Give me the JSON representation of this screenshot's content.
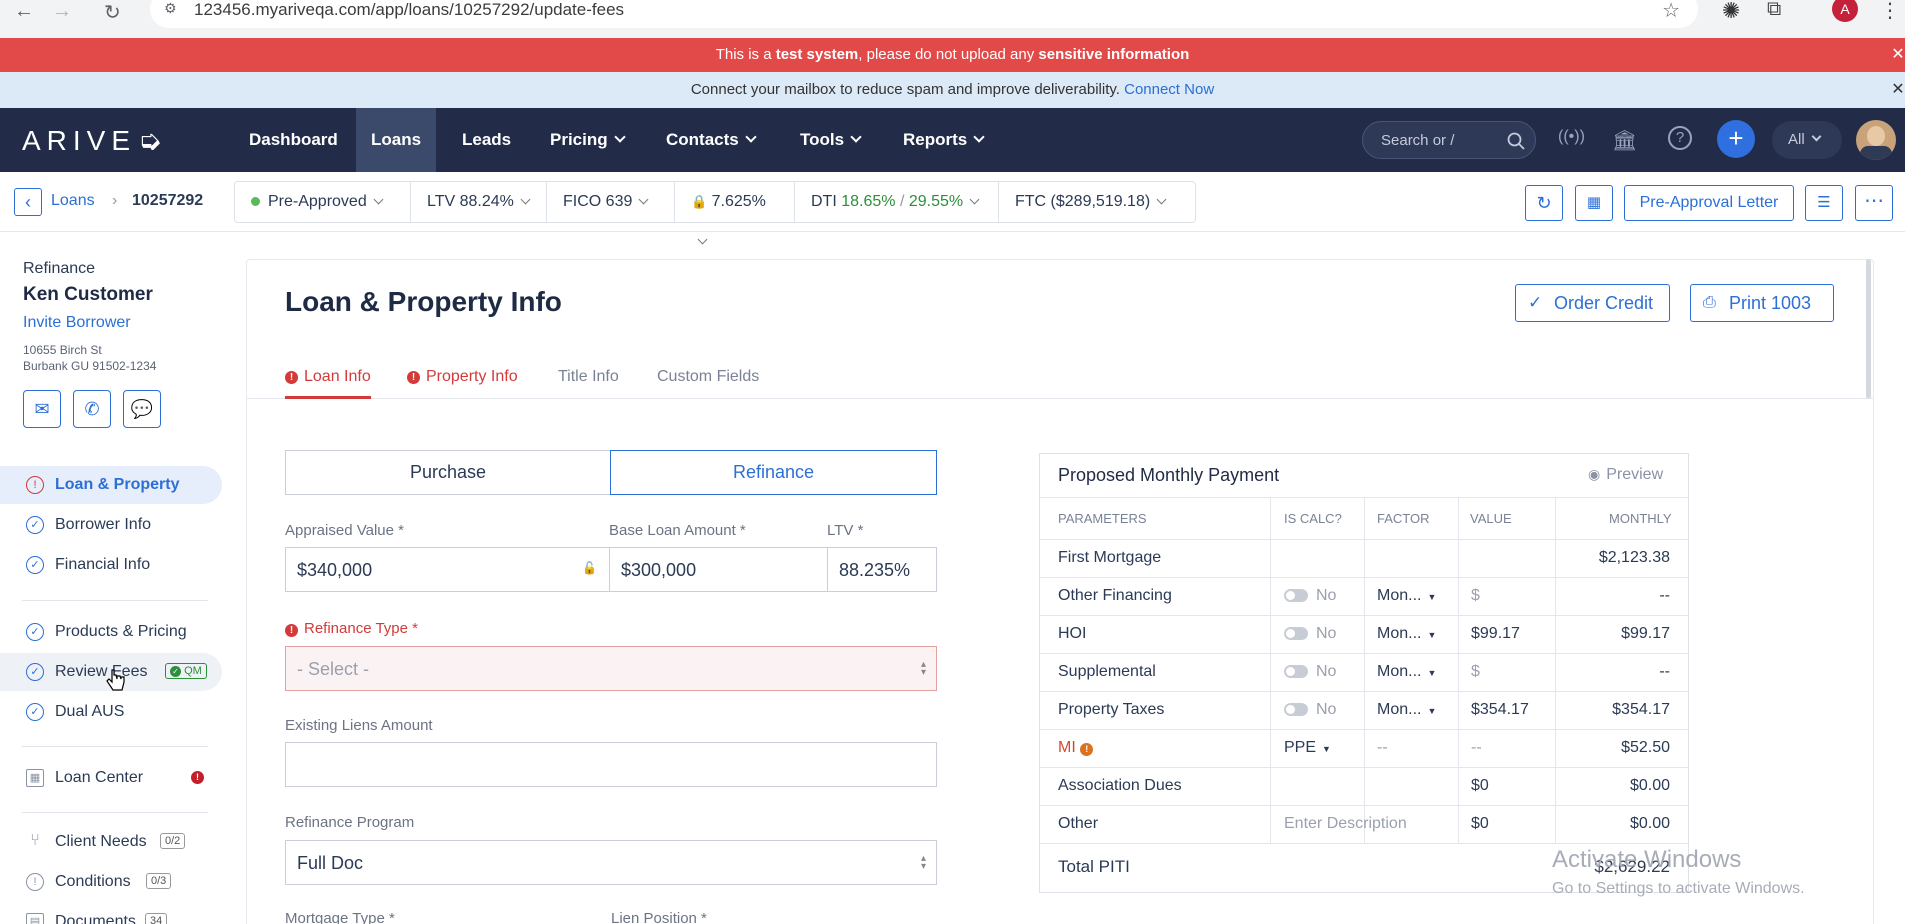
{
  "browser": {
    "url": "123456.myariveqa.com/app/loans/10257292/update-fees",
    "profile_initial": "A"
  },
  "banners": {
    "warning_prefix": "This is a ",
    "warning_bold1": "test system",
    "warning_mid": ", please do not upload any ",
    "warning_bold2": "sensitive information",
    "mailbox_text": "Connect your mailbox to reduce spam and improve deliverability.",
    "mailbox_link": "Connect Now"
  },
  "nav": {
    "logo": "ARIVE",
    "items": [
      {
        "label": "Dashboard"
      },
      {
        "label": "Loans"
      },
      {
        "label": "Leads"
      },
      {
        "label": "Pricing"
      },
      {
        "label": "Contacts"
      },
      {
        "label": "Tools"
      },
      {
        "label": "Reports"
      }
    ],
    "search_placeholder": "Search or /",
    "filter": "All"
  },
  "loanbar": {
    "crumb_loans": "Loans",
    "loan_number": "10257292",
    "status": "Pre-Approved",
    "ltv_label": "LTV",
    "ltv_value": "88.24%",
    "fico_label": "FICO",
    "fico_value": "639",
    "rate": "7.625%",
    "dti_label": "DTI",
    "dti_front": "18.65%",
    "dti_sep": " / ",
    "dti_back": "29.55%",
    "ftc": "FTC ($289,519.18)",
    "pre_approval_letter": "Pre-Approval Letter"
  },
  "borrower": {
    "loan_type": "Refinance",
    "name": "Ken Customer",
    "invite": "Invite Borrower",
    "address1": "10655 Birch St",
    "address2": "Burbank GU 91502-1234"
  },
  "sidebar": {
    "items": [
      {
        "label": "Loan & Property"
      },
      {
        "label": "Borrower Info"
      },
      {
        "label": "Financial Info"
      },
      {
        "label": "Products & Pricing"
      },
      {
        "label": "Review Fees",
        "badge": "QM"
      },
      {
        "label": "Dual AUS"
      },
      {
        "label": "Loan Center"
      },
      {
        "label": "Client Needs",
        "badge": "0/2"
      },
      {
        "label": "Conditions",
        "badge": "0/3"
      },
      {
        "label": "Documents",
        "badge": "34"
      }
    ]
  },
  "main": {
    "title": "Loan & Property Info",
    "order_credit": "Order Credit",
    "print_1003": "Print 1003",
    "tabs": [
      {
        "label": "Loan Info"
      },
      {
        "label": "Property Info"
      },
      {
        "label": "Title Info"
      },
      {
        "label": "Custom Fields"
      }
    ],
    "purpose_options": [
      "Purchase",
      "Refinance"
    ],
    "appraised_label": "Appraised Value *",
    "appraised_value": "$340,000",
    "base_loan_label": "Base Loan Amount *",
    "base_loan_value": "$300,000",
    "ltv_label": "LTV *",
    "ltv_value": "88.235%",
    "refi_type_label": "Refinance Type *",
    "refi_type_value": "- Select -",
    "liens_label": "Existing Liens Amount",
    "liens_value": "",
    "refi_program_label": "Refinance Program",
    "refi_program_value": "Full Doc",
    "mortgage_type_label": "Mortgage Type *",
    "lien_position_label": "Lien Position *"
  },
  "payment": {
    "title": "Proposed Monthly Payment",
    "preview": "Preview",
    "headers": [
      "PARAMETERS",
      "IS CALC?",
      "FACTOR",
      "VALUE",
      "MONTHLY"
    ],
    "rows": [
      {
        "param": "First Mortgage",
        "calc": "",
        "factor": "",
        "value": "",
        "monthly": "$2,123.38"
      },
      {
        "param": "Other Financing",
        "calc": "No",
        "factor": "Mon...",
        "value": "$",
        "monthly": "--"
      },
      {
        "param": "HOI",
        "calc": "No",
        "factor": "Mon...",
        "value": "$99.17",
        "monthly": "$99.17"
      },
      {
        "param": "Supplemental",
        "calc": "No",
        "factor": "Mon...",
        "value": "$",
        "monthly": "--"
      },
      {
        "param": "Property Taxes",
        "calc": "No",
        "factor": "Mon...",
        "value": "$354.17",
        "monthly": "$354.17"
      },
      {
        "param": "MI",
        "calc": "PPE",
        "factor": "--",
        "value": "--",
        "monthly": "$52.50"
      },
      {
        "param": "Association Dues",
        "calc": "",
        "factor": "",
        "value": "$0",
        "monthly": "$0.00"
      },
      {
        "param": "Other",
        "calc": "Enter Description",
        "factor": "",
        "value": "$0",
        "monthly": "$0.00"
      }
    ],
    "total_label": "Total PITI",
    "total_value": "$2,629.22"
  },
  "watermark": {
    "line1": "Activate Windows",
    "line2": "Go to Settings to activate Windows."
  },
  "colors": {
    "nav_bg": "#222c48",
    "accent": "#2c6fd6",
    "error": "#d33a3a",
    "warning_banner": "#e24a4a"
  }
}
